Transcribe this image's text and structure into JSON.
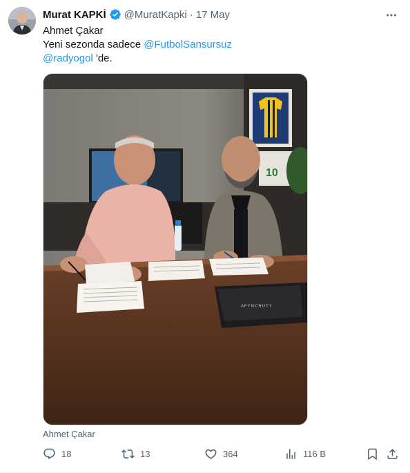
{
  "author": {
    "display_name": "Murat KAPKİ",
    "handle": "@MuratKapki",
    "separator": "·",
    "date": "17 May"
  },
  "tweet": {
    "line1": "Ahmet Çakar",
    "line2_prefix": "Yeni sezonda sadece ",
    "mention1": "@FutbolSansursuz",
    "mention2": "@radyogol",
    "line3_suffix": " 'de."
  },
  "media": {
    "caption": "Ahmet Çakar",
    "folder_brand": "AFYNCRUTY"
  },
  "actions": {
    "replies": "18",
    "retweets": "13",
    "likes": "364",
    "views": "116 B"
  },
  "icons": {
    "verified": "verified-badge-icon",
    "more": "more-dots-icon",
    "reply": "reply-icon",
    "retweet": "retweet-icon",
    "like": "heart-icon",
    "views": "views-icon",
    "bookmark": "bookmark-icon",
    "share": "share-icon"
  },
  "colors": {
    "accent": "#1d9bf0",
    "secondary_text": "#536471",
    "primary_text": "#0f1419"
  }
}
